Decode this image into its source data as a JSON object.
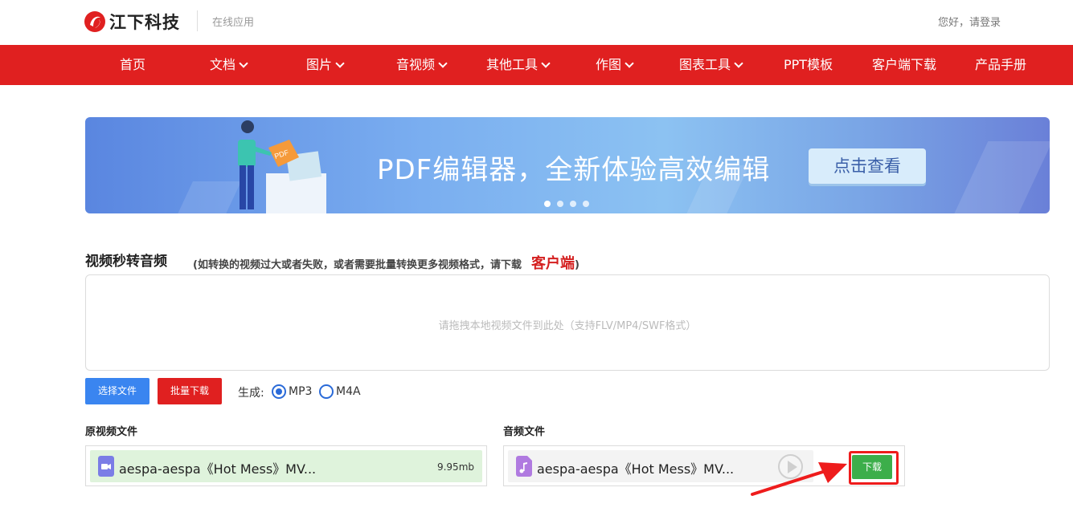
{
  "header": {
    "logo_text": "江下科技",
    "logo_sub": "在线应用",
    "login_text": "您好，请登录",
    "brand_color": "#e02020"
  },
  "nav": {
    "items": [
      {
        "label": "首页",
        "dropdown": false
      },
      {
        "label": "文档",
        "dropdown": true
      },
      {
        "label": "图片",
        "dropdown": true
      },
      {
        "label": "音视频",
        "dropdown": true
      },
      {
        "label": "其他工具",
        "dropdown": true
      },
      {
        "label": "作图",
        "dropdown": true
      },
      {
        "label": "图表工具",
        "dropdown": true
      },
      {
        "label": "PPT模板",
        "dropdown": false
      },
      {
        "label": "客户端下载",
        "dropdown": false
      },
      {
        "label": "产品手册",
        "dropdown": false
      }
    ]
  },
  "banner": {
    "title": "PDF编辑器，全新体验高效编辑",
    "button": "点击查看",
    "illus_badge": "PDF",
    "dots": 4,
    "active_dot": 0
  },
  "section": {
    "title": "视频秒转音频",
    "note_prefix": "(如转换的视频过大或者失败，或者需要批量转换更多视频格式，请下载",
    "note_link": "客户端",
    "note_suffix": ")"
  },
  "dropzone": {
    "text": "请拖拽本地视频文件到此处（支持FLV/MP4/SWF格式）"
  },
  "actions": {
    "choose_file": "选择文件",
    "batch_download": "批量下载",
    "generate_label": "生成:",
    "formats": [
      {
        "label": "MP3",
        "selected": true
      },
      {
        "label": "M4A",
        "selected": false
      }
    ]
  },
  "original": {
    "label": "原视频文件",
    "file_name": "aespa-aespa《Hot Mess》MV...",
    "file_size": "9.95mb",
    "icon": "video-file-icon"
  },
  "audio": {
    "label": "音频文件",
    "file_name": "aespa-aespa《Hot Mess》MV...",
    "download": "下载",
    "icon": "audio-file-icon"
  }
}
